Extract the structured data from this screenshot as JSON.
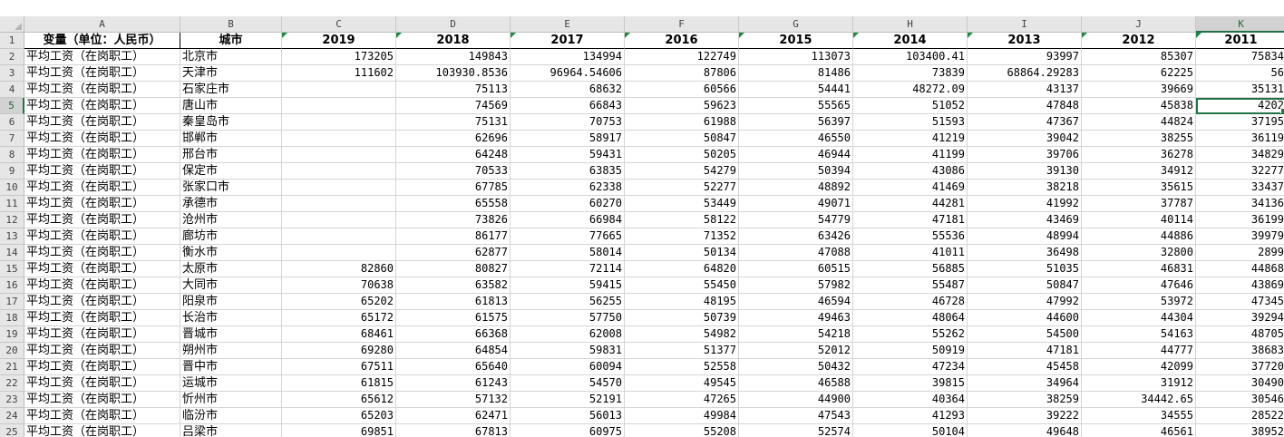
{
  "columns": [
    {
      "letter": "A",
      "width": 172
    },
    {
      "letter": "B",
      "width": 112
    },
    {
      "letter": "C",
      "width": 126
    },
    {
      "letter": "D",
      "width": 126
    },
    {
      "letter": "E",
      "width": 126
    },
    {
      "letter": "F",
      "width": 126
    },
    {
      "letter": "G",
      "width": 126
    },
    {
      "letter": "H",
      "width": 126
    },
    {
      "letter": "I",
      "width": 126
    },
    {
      "letter": "J",
      "width": 126
    },
    {
      "letter": "K",
      "width": 100
    }
  ],
  "header_row": [
    "变量（单位：人民币）",
    "城市",
    "2019",
    "2018",
    "2017",
    "2016",
    "2015",
    "2014",
    "2013",
    "2012",
    "2011"
  ],
  "rows": [
    [
      "平均工资（在岗职工）",
      "北京市",
      "173205",
      "149843",
      "134994",
      "122749",
      "113073",
      "103400.41",
      "93997",
      "85307",
      "75834"
    ],
    [
      "平均工资（在岗职工）",
      "天津市",
      "111602",
      "103930.8536",
      "96964.54606",
      "87806",
      "81486",
      "73839",
      "68864.29283",
      "62225",
      "56"
    ],
    [
      "平均工资（在岗职工）",
      "石家庄市",
      "",
      "75113",
      "68632",
      "60566",
      "54441",
      "48272.09",
      "43137",
      "39669",
      "35131"
    ],
    [
      "平均工资（在岗职工）",
      "唐山市",
      "",
      "74569",
      "66843",
      "59623",
      "55565",
      "51052",
      "47848",
      "45838",
      "4202"
    ],
    [
      "平均工资（在岗职工）",
      "秦皇岛市",
      "",
      "75131",
      "70753",
      "61988",
      "56397",
      "51593",
      "47367",
      "44824",
      "37195"
    ],
    [
      "平均工资（在岗职工）",
      "邯郸市",
      "",
      "62696",
      "58917",
      "50847",
      "46550",
      "41219",
      "39042",
      "38255",
      "36119"
    ],
    [
      "平均工资（在岗职工）",
      "邢台市",
      "",
      "64248",
      "59431",
      "50205",
      "46944",
      "41199",
      "39706",
      "36278",
      "34829"
    ],
    [
      "平均工资（在岗职工）",
      "保定市",
      "",
      "70533",
      "63835",
      "54279",
      "50394",
      "43086",
      "39130",
      "34912",
      "32277"
    ],
    [
      "平均工资（在岗职工）",
      "张家口市",
      "",
      "67785",
      "62338",
      "52277",
      "48892",
      "41469",
      "38218",
      "35615",
      "33437"
    ],
    [
      "平均工资（在岗职工）",
      "承德市",
      "",
      "65558",
      "60270",
      "53449",
      "49071",
      "44281",
      "41992",
      "37787",
      "34136"
    ],
    [
      "平均工资（在岗职工）",
      "沧州市",
      "",
      "73826",
      "66984",
      "58122",
      "54779",
      "47181",
      "43469",
      "40114",
      "36199"
    ],
    [
      "平均工资（在岗职工）",
      "廊坊市",
      "",
      "86177",
      "77665",
      "71352",
      "63426",
      "55536",
      "48994",
      "44886",
      "39979"
    ],
    [
      "平均工资（在岗职工）",
      "衡水市",
      "",
      "62877",
      "58014",
      "50134",
      "47088",
      "41011",
      "36498",
      "32800",
      "2899"
    ],
    [
      "平均工资（在岗职工）",
      "太原市",
      "82860",
      "80827",
      "72114",
      "64820",
      "60515",
      "56885",
      "51035",
      "46831",
      "44868"
    ],
    [
      "平均工资（在岗职工）",
      "大同市",
      "70638",
      "63582",
      "59415",
      "55450",
      "57982",
      "55487",
      "50847",
      "47646",
      "43869"
    ],
    [
      "平均工资（在岗职工）",
      "阳泉市",
      "65202",
      "61813",
      "56255",
      "48195",
      "46594",
      "46728",
      "47992",
      "53972",
      "47345"
    ],
    [
      "平均工资（在岗职工）",
      "长治市",
      "65172",
      "61575",
      "57750",
      "50739",
      "49463",
      "48064",
      "44600",
      "44304",
      "39294"
    ],
    [
      "平均工资（在岗职工）",
      "晋城市",
      "68461",
      "66368",
      "62008",
      "54982",
      "54218",
      "55262",
      "54500",
      "54163",
      "48705"
    ],
    [
      "平均工资（在岗职工）",
      "朔州市",
      "69280",
      "64854",
      "59831",
      "51377",
      "52012",
      "50919",
      "47181",
      "44777",
      "38683"
    ],
    [
      "平均工资（在岗职工）",
      "晋中市",
      "67511",
      "65640",
      "60094",
      "52558",
      "50432",
      "47234",
      "45458",
      "42099",
      "37720"
    ],
    [
      "平均工资（在岗职工）",
      "运城市",
      "61815",
      "61243",
      "54570",
      "49545",
      "46588",
      "39815",
      "34964",
      "31912",
      "30490"
    ],
    [
      "平均工资（在岗职工）",
      "忻州市",
      "65612",
      "57132",
      "52191",
      "47265",
      "44900",
      "40364",
      "38259",
      "34442.65",
      "30546"
    ],
    [
      "平均工资（在岗职工）",
      "临汾市",
      "65203",
      "62471",
      "56013",
      "49984",
      "47543",
      "41293",
      "39222",
      "34555",
      "28522"
    ],
    [
      "平均工资（在岗职工）",
      "吕梁市",
      "69851",
      "67813",
      "60975",
      "55208",
      "52574",
      "50104",
      "49648",
      "46561",
      "38952"
    ]
  ]
}
